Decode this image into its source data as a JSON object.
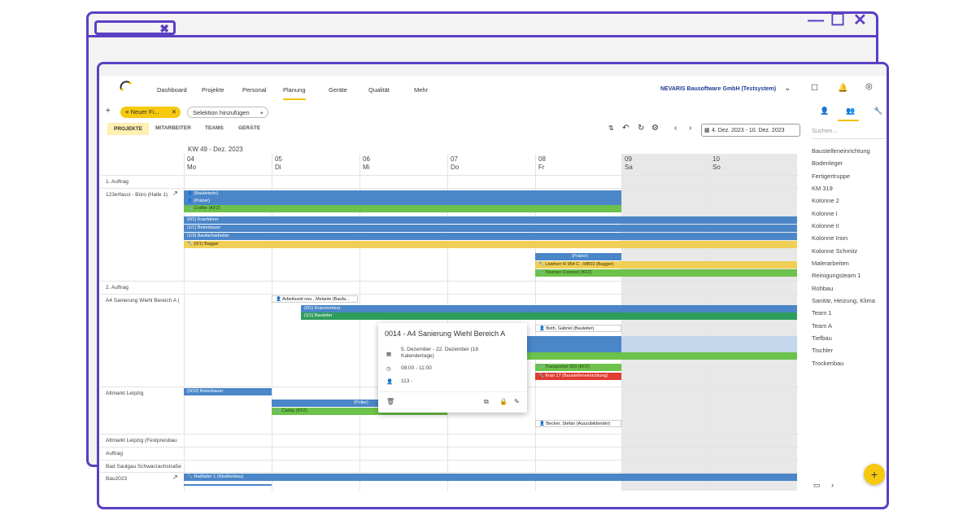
{
  "browser": {
    "close_glyph": "✖",
    "minimize_glyph": "—",
    "maximize_glyph": "☐",
    "close_window_glyph": "✕"
  },
  "nav": {
    "items": [
      "Dashboard",
      "Projekte",
      "Personal",
      "Planung",
      "Geräte",
      "Qualität",
      "Mehr"
    ],
    "active": "Planung",
    "company": "NEVARIS Bausoftware GmbH (Testsystem)"
  },
  "toolbar": {
    "filter_chip": "Neuer Fi...",
    "selection_label": "Selektion hinzufügen",
    "subtabs": [
      "PROJEKTE",
      "MITARBEITER",
      "TEAMS",
      "GERÄTE"
    ],
    "date_range": "4. Dez. 2023 - 10. Dez. 2023"
  },
  "calendar": {
    "week_label": "KW 49 - Dez. 2023",
    "days": [
      {
        "num": "04",
        "name": "Mo"
      },
      {
        "num": "05",
        "name": "Di"
      },
      {
        "num": "06",
        "name": "Mi"
      },
      {
        "num": "07",
        "name": "Do"
      },
      {
        "num": "08",
        "name": "Fr"
      },
      {
        "num": "09",
        "name": "Sa"
      },
      {
        "num": "10",
        "name": "So"
      }
    ],
    "rows": [
      "1. Auftrag",
      "123erfasst - Büro (Halle 1)",
      "2. Auftrag",
      "A4 Sanierung Wiehl Bereich A (",
      "Altmarkt Leipzig",
      "Altmarkt Leipzig (Festpreisbau",
      "Auftrag",
      "Bad Saulgau Schwarzachstraße",
      "Bau2023"
    ],
    "bars": [
      "(Bauleiterin)",
      "(Putzer)",
      "Crafter (KFZ)",
      "(0/1) Kranfahrer",
      "(1/1) Betonbauer",
      "(1/3) Baufacharbeiter",
      "(0/1) Bagger",
      "(Putzer)",
      "Liebherr R 954 C - MB02 (Bagger)",
      "Tourneo Connect (KFZ)",
      "Arbeitszeit neu , Melanie (Baufa...",
      "(0/1) Kranmonteur",
      "(1/1) Bauleiter",
      "Both, Gabriel (Bauleiter)",
      "Transporter 003 (KFZ)",
      "Kran 17 (Baustelleneinrichtung)",
      "(0/10) Betonbauer",
      "(Polier)",
      "Caddy (KFZ)",
      "Becker, Stefan (Auszubildender)",
      "Radlader 1 (Straßenbau)"
    ]
  },
  "popup": {
    "title": "0014 - A4 Sanierung Wiehl Bereich A",
    "date": "5. Dezember - 22. Dezember (18 Kalendertage)",
    "time": "08:00 - 11:00",
    "people": "113 -"
  },
  "sidebar": {
    "search_placeholder": "Suchen...",
    "items": [
      "Baustelleneinrichtung",
      "Bodenleger",
      "Fertigertruppe",
      "KM 319",
      "Kolonne 2",
      "Kolonne I",
      "Kolonne II",
      "Kolonne Irion",
      "Kolonne Schmitz",
      "Malerarbeiten",
      "Reinigungsteam 1",
      "Rohbau",
      "Sanitär, Heizung, Klima",
      "Team 1",
      "Team A",
      "Tiefbau",
      "Tischler",
      "Trockenbau"
    ]
  },
  "fab_label": "+"
}
